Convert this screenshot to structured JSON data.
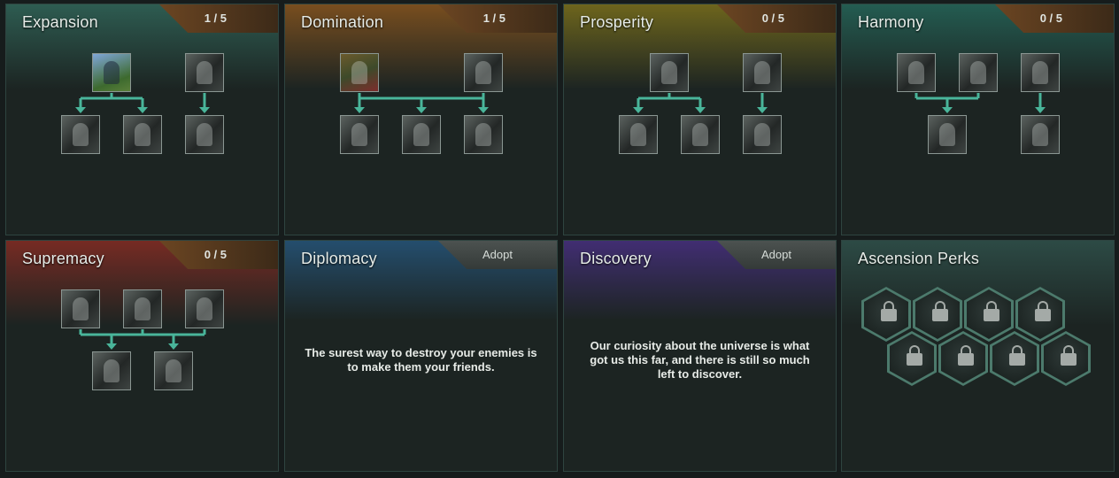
{
  "colors": {
    "expansion": "#3c8a78",
    "domination": "#c4701c",
    "prosperity": "#b09a18",
    "harmony": "#2a8a78",
    "supremacy": "#c03024",
    "diplomacy": "#2a6aa0",
    "discovery": "#5a34a8",
    "ascension": "#3a6a62",
    "connector": "#49b59a"
  },
  "panels": {
    "expansion": {
      "title": "Expansion",
      "progress": "1 / 5"
    },
    "domination": {
      "title": "Domination",
      "progress": "1 / 5"
    },
    "prosperity": {
      "title": "Prosperity",
      "progress": "0 / 5"
    },
    "harmony": {
      "title": "Harmony",
      "progress": "0 / 5"
    },
    "supremacy": {
      "title": "Supremacy",
      "progress": "0 / 5"
    },
    "diplomacy": {
      "title": "Diplomacy",
      "adopt_label": "Adopt",
      "quote": "The surest way to destroy your enemies is to make them your friends."
    },
    "discovery": {
      "title": "Discovery",
      "adopt_label": "Adopt",
      "quote": "Our curiosity about the universe is what got us this far, and there is still so much left to discover."
    },
    "ascension": {
      "title": "Ascension Perks",
      "slot_count": 8
    }
  }
}
